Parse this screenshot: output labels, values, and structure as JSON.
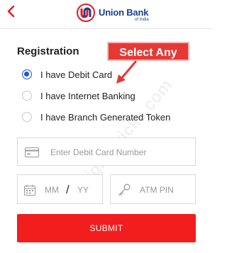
{
  "header": {
    "back_icon": "chevron-left-icon",
    "logo_text": "Union Bank",
    "logo_sub": "of India",
    "brand_red": "#e31b23",
    "brand_blue": "#1b3f8f"
  },
  "registration": {
    "title": "Registration",
    "options": [
      {
        "label": "I have Debit Card",
        "selected": true
      },
      {
        "label": "I have Internet Banking",
        "selected": false
      },
      {
        "label": "I have Branch Generated Token",
        "selected": false
      }
    ]
  },
  "callout": {
    "text": "Select  Any",
    "color": "#e53935"
  },
  "fields": {
    "card_placeholder": "Enter Debit Card Number",
    "card_icon": "credit-card-icon",
    "mm_placeholder": "MM",
    "yy_placeholder": "YY",
    "slash": "/",
    "calendar_icon": "calendar-icon",
    "pin_placeholder": "ATM PIN",
    "key_icon": "key-icon"
  },
  "submit": {
    "label": "SUBMIT",
    "color": "#f21d1d"
  },
  "watermark": "alldigitaltricks.com"
}
